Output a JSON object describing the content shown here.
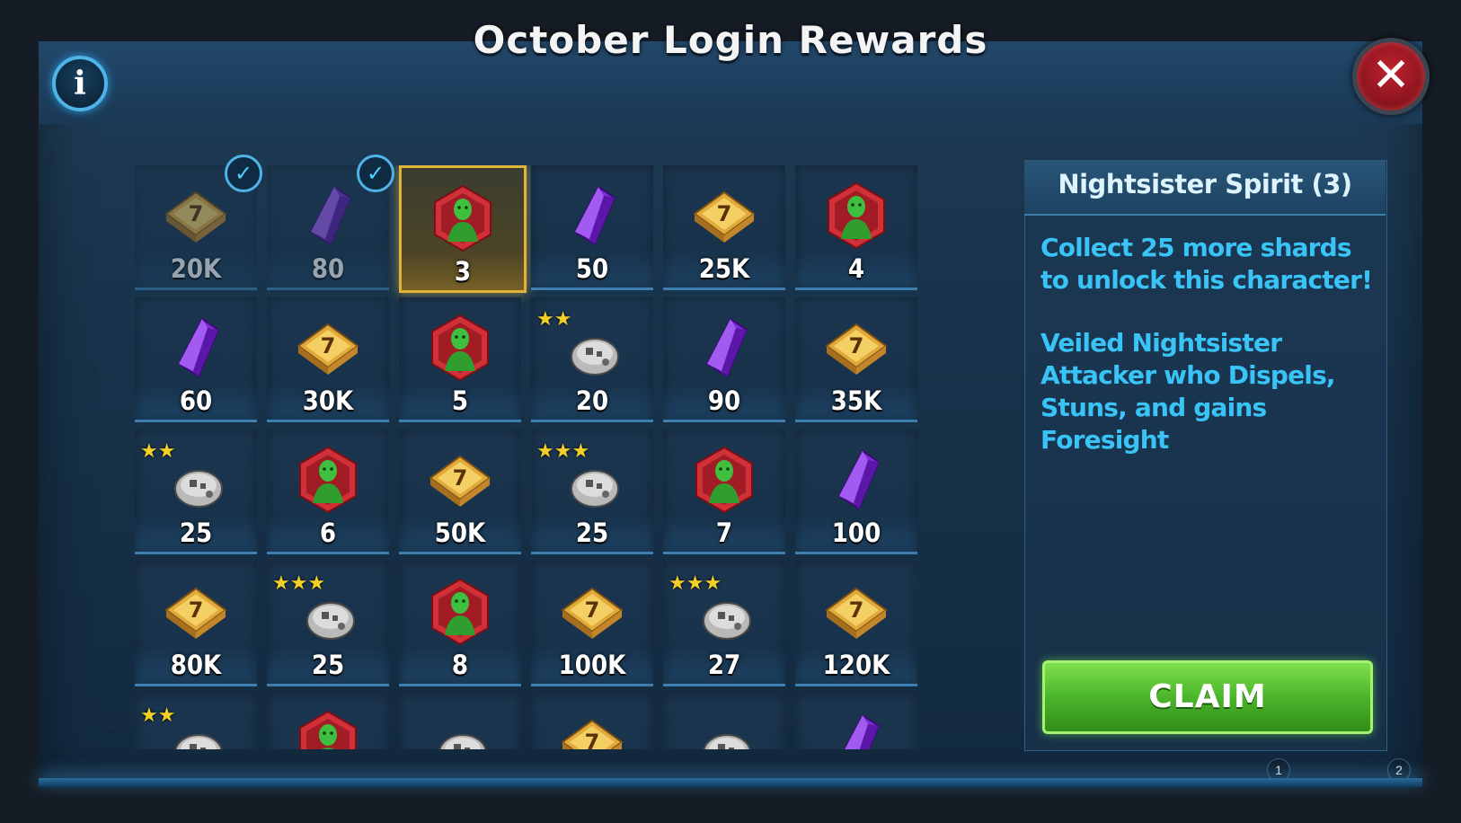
{
  "title": "October Login Rewards",
  "info_icon": "info-icon",
  "close_icon": "close-icon",
  "rewards": [
    {
      "type": "credits",
      "qty": "20K",
      "claimed": true
    },
    {
      "type": "crystals",
      "qty": "80",
      "claimed": true
    },
    {
      "type": "shard",
      "qty": "3",
      "current": true
    },
    {
      "type": "crystals",
      "qty": "50"
    },
    {
      "type": "credits",
      "qty": "25K"
    },
    {
      "type": "shard",
      "qty": "4"
    },
    {
      "type": "crystals",
      "qty": "60"
    },
    {
      "type": "credits",
      "qty": "30K"
    },
    {
      "type": "shard",
      "qty": "5"
    },
    {
      "type": "droid",
      "stars": 2,
      "qty": "20"
    },
    {
      "type": "crystals",
      "qty": "90"
    },
    {
      "type": "credits",
      "qty": "35K"
    },
    {
      "type": "droid",
      "stars": 2,
      "qty": "25"
    },
    {
      "type": "shard",
      "qty": "6"
    },
    {
      "type": "credits",
      "qty": "50K"
    },
    {
      "type": "droid",
      "stars": 3,
      "qty": "25"
    },
    {
      "type": "shard",
      "qty": "7"
    },
    {
      "type": "crystals",
      "qty": "100"
    },
    {
      "type": "credits",
      "qty": "80K"
    },
    {
      "type": "droid",
      "stars": 3,
      "qty": "25"
    },
    {
      "type": "shard",
      "qty": "8"
    },
    {
      "type": "credits",
      "qty": "100K"
    },
    {
      "type": "droid",
      "stars": 3,
      "qty": "27"
    },
    {
      "type": "credits",
      "qty": "120K"
    },
    {
      "type": "droid",
      "stars": 2,
      "qty": ""
    },
    {
      "type": "shard",
      "qty": ""
    },
    {
      "type": "droid",
      "qty": ""
    },
    {
      "type": "credits",
      "qty": ""
    },
    {
      "type": "droid",
      "qty": ""
    },
    {
      "type": "crystals",
      "qty": ""
    }
  ],
  "detail": {
    "title": "Nightsister Spirit (3)",
    "line1": "Collect 25 more shards to unlock this character!",
    "line2": "Veiled Nightsister Attacker who Dispels, Stuns, and gains Foresight"
  },
  "claim_label": "CLAIM",
  "pages": [
    "1",
    "2"
  ],
  "colors": {
    "accent_blue": "#39c3f7",
    "claim_green": "#4bb52a",
    "current_gold": "#e0b43a",
    "close_red": "#c0232f"
  }
}
